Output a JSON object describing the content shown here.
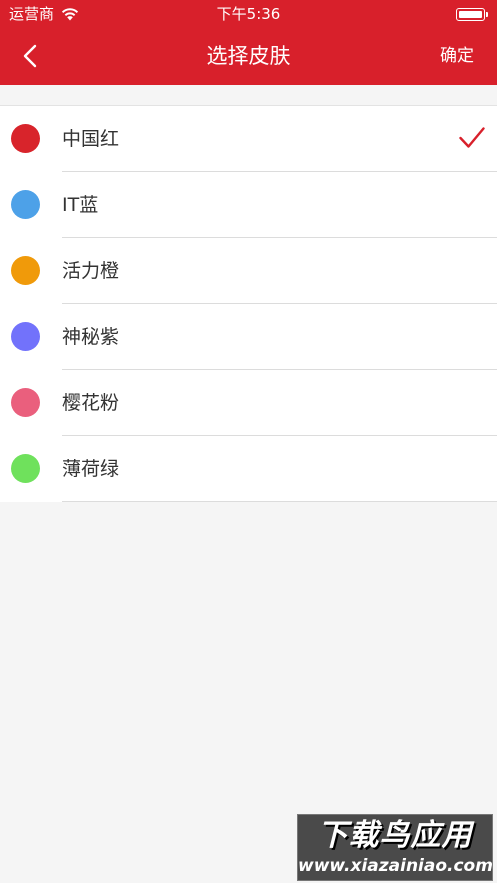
{
  "status_bar": {
    "carrier": "运营商",
    "time": "下午5:36"
  },
  "nav": {
    "title": "选择皮肤",
    "confirm_label": "确定"
  },
  "skins": [
    {
      "label": "中国红",
      "color": "#d8242b",
      "selected": true
    },
    {
      "label": "IT蓝",
      "color": "#4da1e8",
      "selected": false
    },
    {
      "label": "活力橙",
      "color": "#f09a0a",
      "selected": false
    },
    {
      "label": "神秘紫",
      "color": "#7272fb",
      "selected": false
    },
    {
      "label": "樱花粉",
      "color": "#ea5f7d",
      "selected": false
    },
    {
      "label": "薄荷绿",
      "color": "#6fe15c",
      "selected": false
    }
  ],
  "theme": {
    "accent": "#d8202b"
  },
  "watermark": {
    "title": "下载鸟应用",
    "url": "www.xiazainiao.com"
  }
}
